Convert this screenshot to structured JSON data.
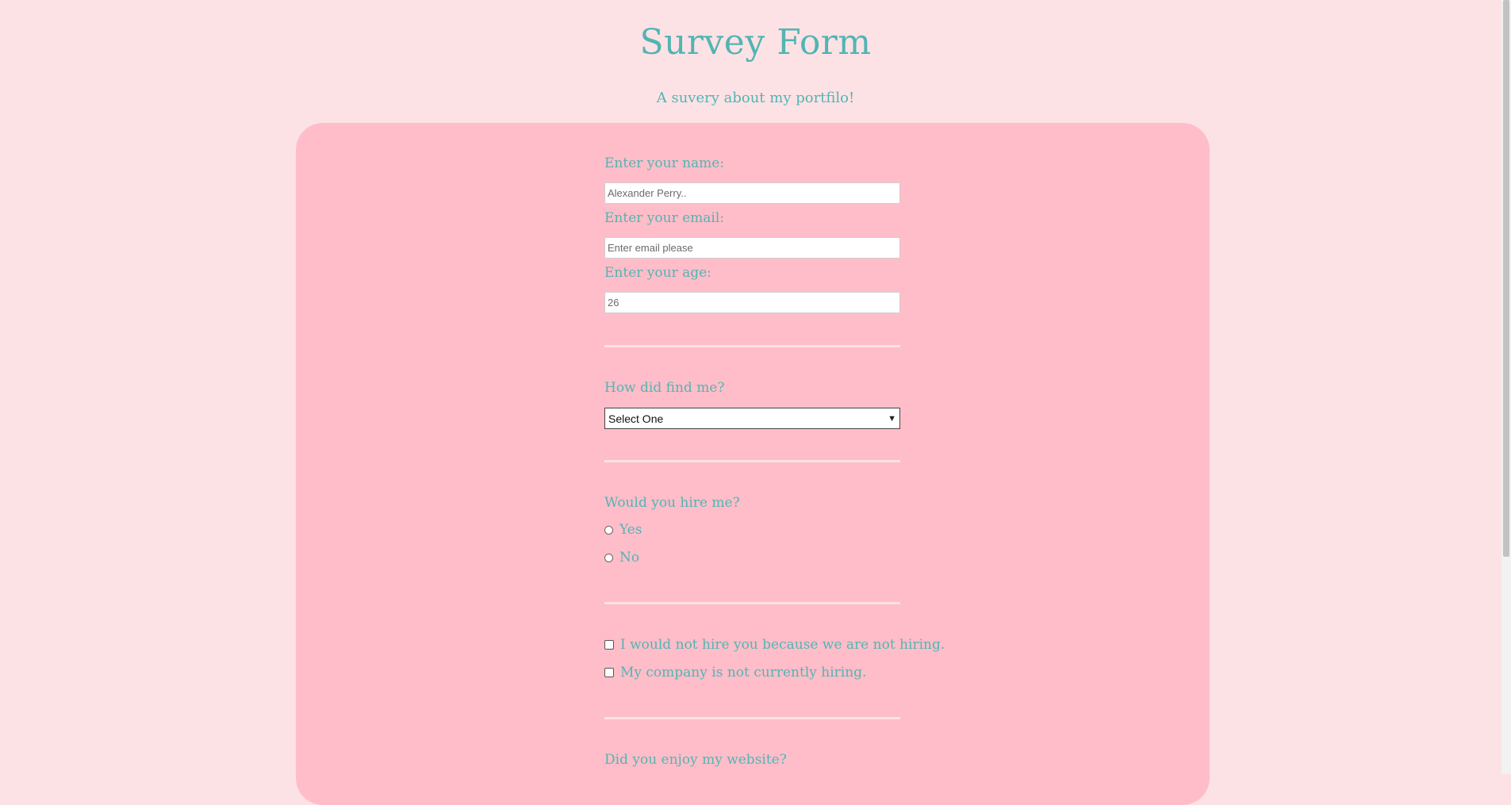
{
  "header": {
    "title": "Survey Form",
    "subtitle": "A suvery about my portfilo!"
  },
  "form": {
    "name_label": "Enter your name:",
    "name_placeholder": "Alexander Perry..",
    "email_label": "Enter your email:",
    "email_placeholder": "Enter email please",
    "age_label": "Enter your age:",
    "age_placeholder": "26",
    "find_label": "How did find me?",
    "find_selected": "Select One",
    "hire_label": "Would you hire me?",
    "hire_options": [
      "Yes",
      "No"
    ],
    "checkbox_options": [
      "I would not hire you because we are not hiring.",
      "My company is not currently hiring."
    ],
    "enjoy_label": "Did you enjoy my website?"
  },
  "colors": {
    "page_bg": "#fde2e5",
    "card_bg": "#ffbdc9",
    "accent_text": "#52b5b2"
  }
}
